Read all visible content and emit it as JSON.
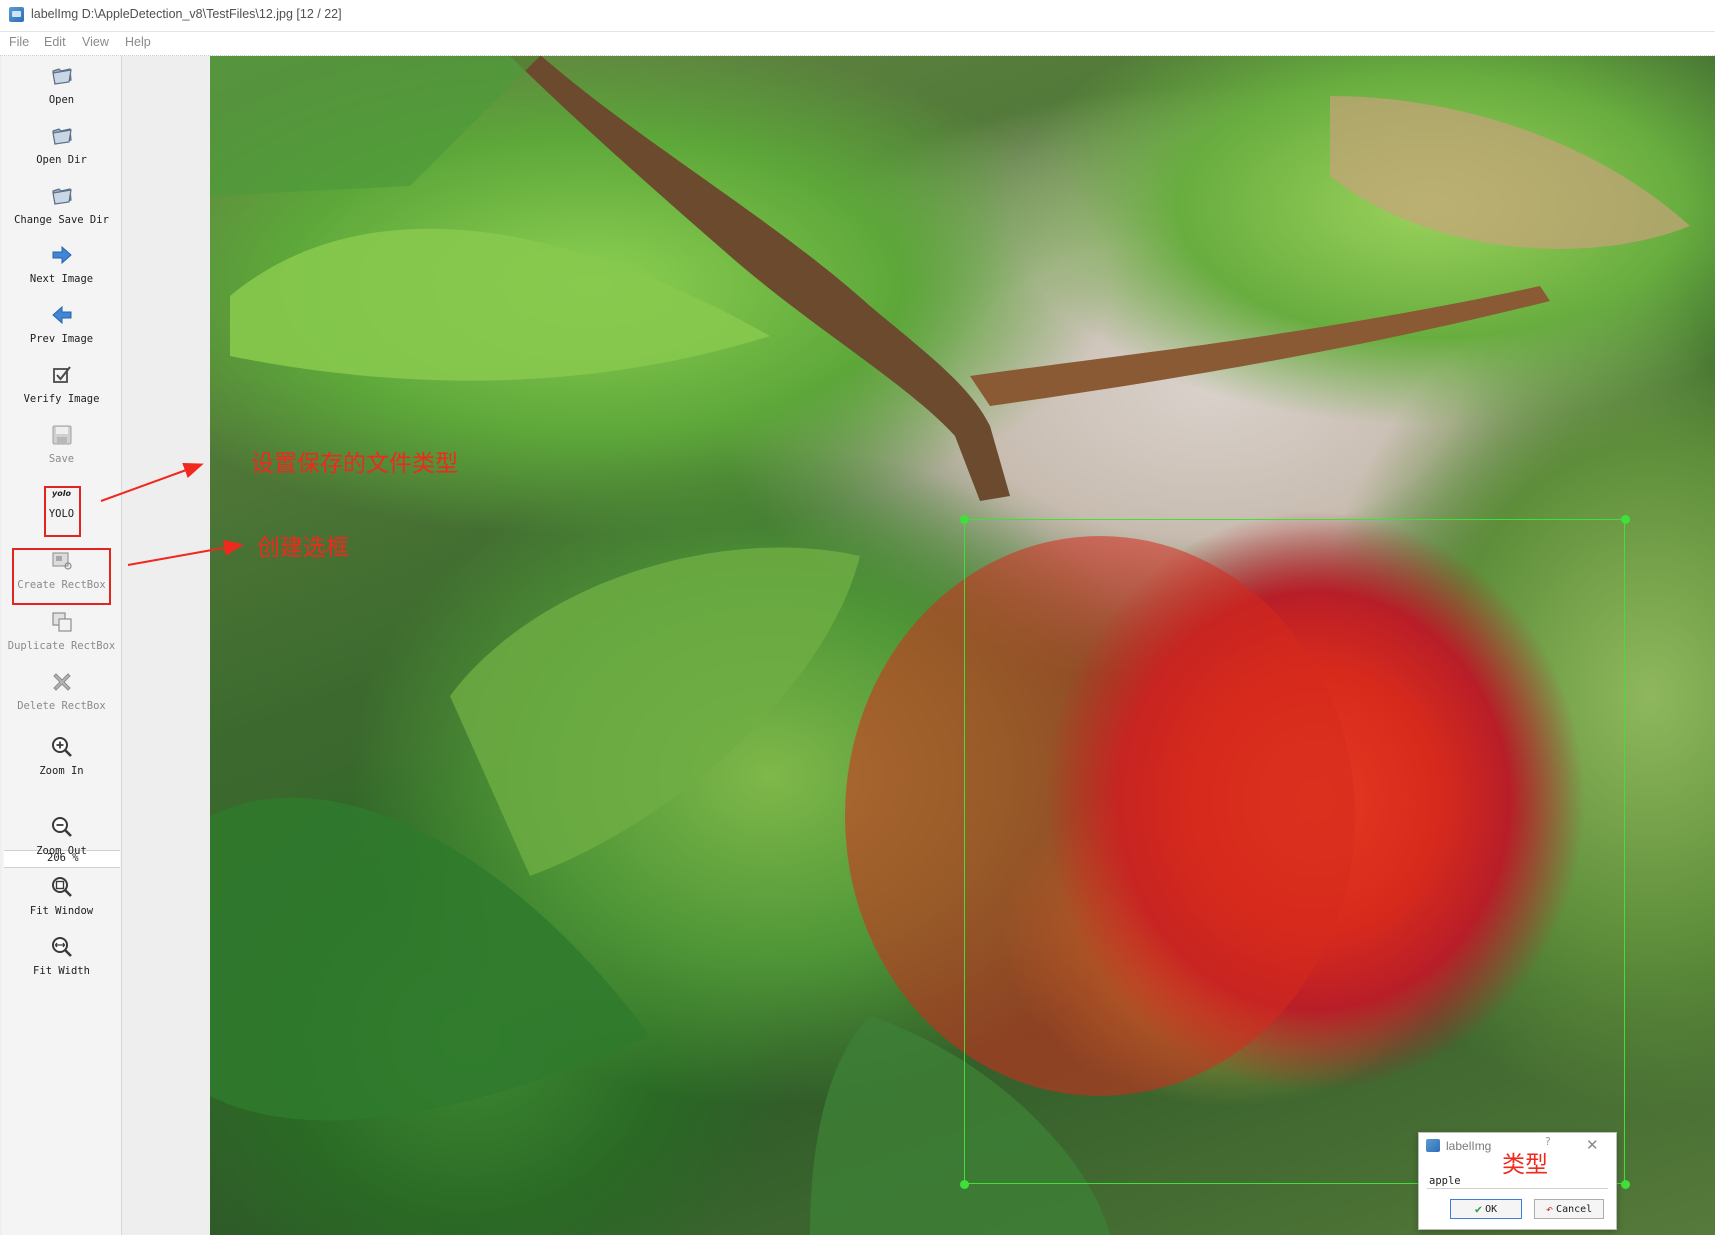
{
  "window": {
    "title": "labelImg D:\\AppleDetection_v8\\TestFiles\\12.jpg [12 / 22]"
  },
  "menu": [
    "File",
    "Edit",
    "View",
    "Help"
  ],
  "toolbar": {
    "open": "Open",
    "open_dir": "Open Dir",
    "change_save_dir": "Change Save Dir",
    "next_image": "Next Image",
    "prev_image": "Prev Image",
    "verify_image": "Verify Image",
    "save": "Save",
    "format_badge": "yolo",
    "format": "YOLO",
    "create_rectbox": "Create RectBox",
    "duplicate_rectbox": "Duplicate RectBox",
    "delete_rectbox": "Delete RectBox",
    "zoom_in": "Zoom In",
    "zoom_value": "206 %",
    "zoom_out": "Zoom Out",
    "fit_window": "Fit Window",
    "fit_width": "Fit Width"
  },
  "annotations": {
    "save_format_note": "设置保存的文件类型",
    "create_box_note": "创建选框",
    "label_type_note": "类型"
  },
  "label_dialog": {
    "title": "labelImg",
    "help": "?",
    "close": "✕",
    "value": "apple",
    "ok": "OK",
    "cancel": "Cancel"
  },
  "colors": {
    "annotation_red": "#f0281e",
    "bbox_green": "#3fe03a",
    "highlight_red": "#e0261f"
  }
}
